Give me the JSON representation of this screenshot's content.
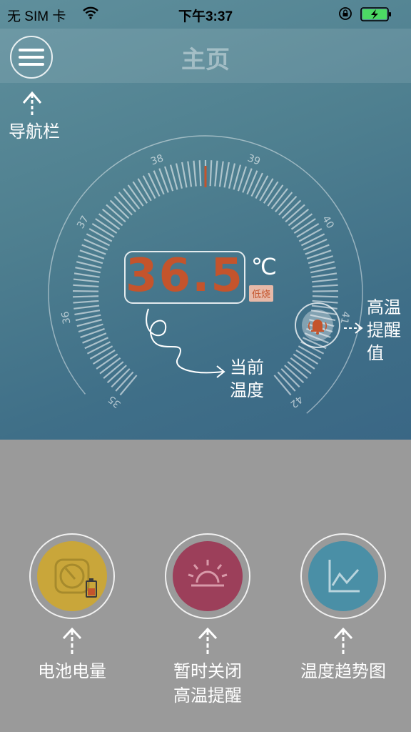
{
  "status_bar": {
    "carrier": "无 SIM 卡",
    "time": "下午3:37",
    "battery_color": "#4cd964"
  },
  "nav": {
    "title": "主页",
    "menu_icon": "hamburger-menu-icon"
  },
  "annotations": {
    "nav_label": "导航栏",
    "current_temp_line1": "当前",
    "current_temp_line2": "温度",
    "alert_line1": "高温",
    "alert_line2": "提醒",
    "alert_line3": "值"
  },
  "gauge": {
    "ticks": [
      "35",
      "36",
      "37",
      "38",
      "39",
      "40",
      "41",
      "42"
    ],
    "min": 35,
    "max": 42,
    "marker_value": 38.5
  },
  "temperature": {
    "value": "36.5",
    "unit": "℃",
    "status": "低烧",
    "value_color": "#c4542c"
  },
  "alarm": {
    "icon": "alarm-bell-icon",
    "color": "#c4542c"
  },
  "buttons": [
    {
      "label": "电池电量",
      "icon": "battery-gauge-icon",
      "color": "#c9a63a"
    },
    {
      "label_line1": "暂时关闭",
      "label_line2": "高温提醒",
      "icon": "siren-light-icon",
      "color": "#9c3f5a"
    },
    {
      "label": "温度趋势图",
      "icon": "line-chart-icon",
      "color": "#4a8fa6"
    }
  ]
}
